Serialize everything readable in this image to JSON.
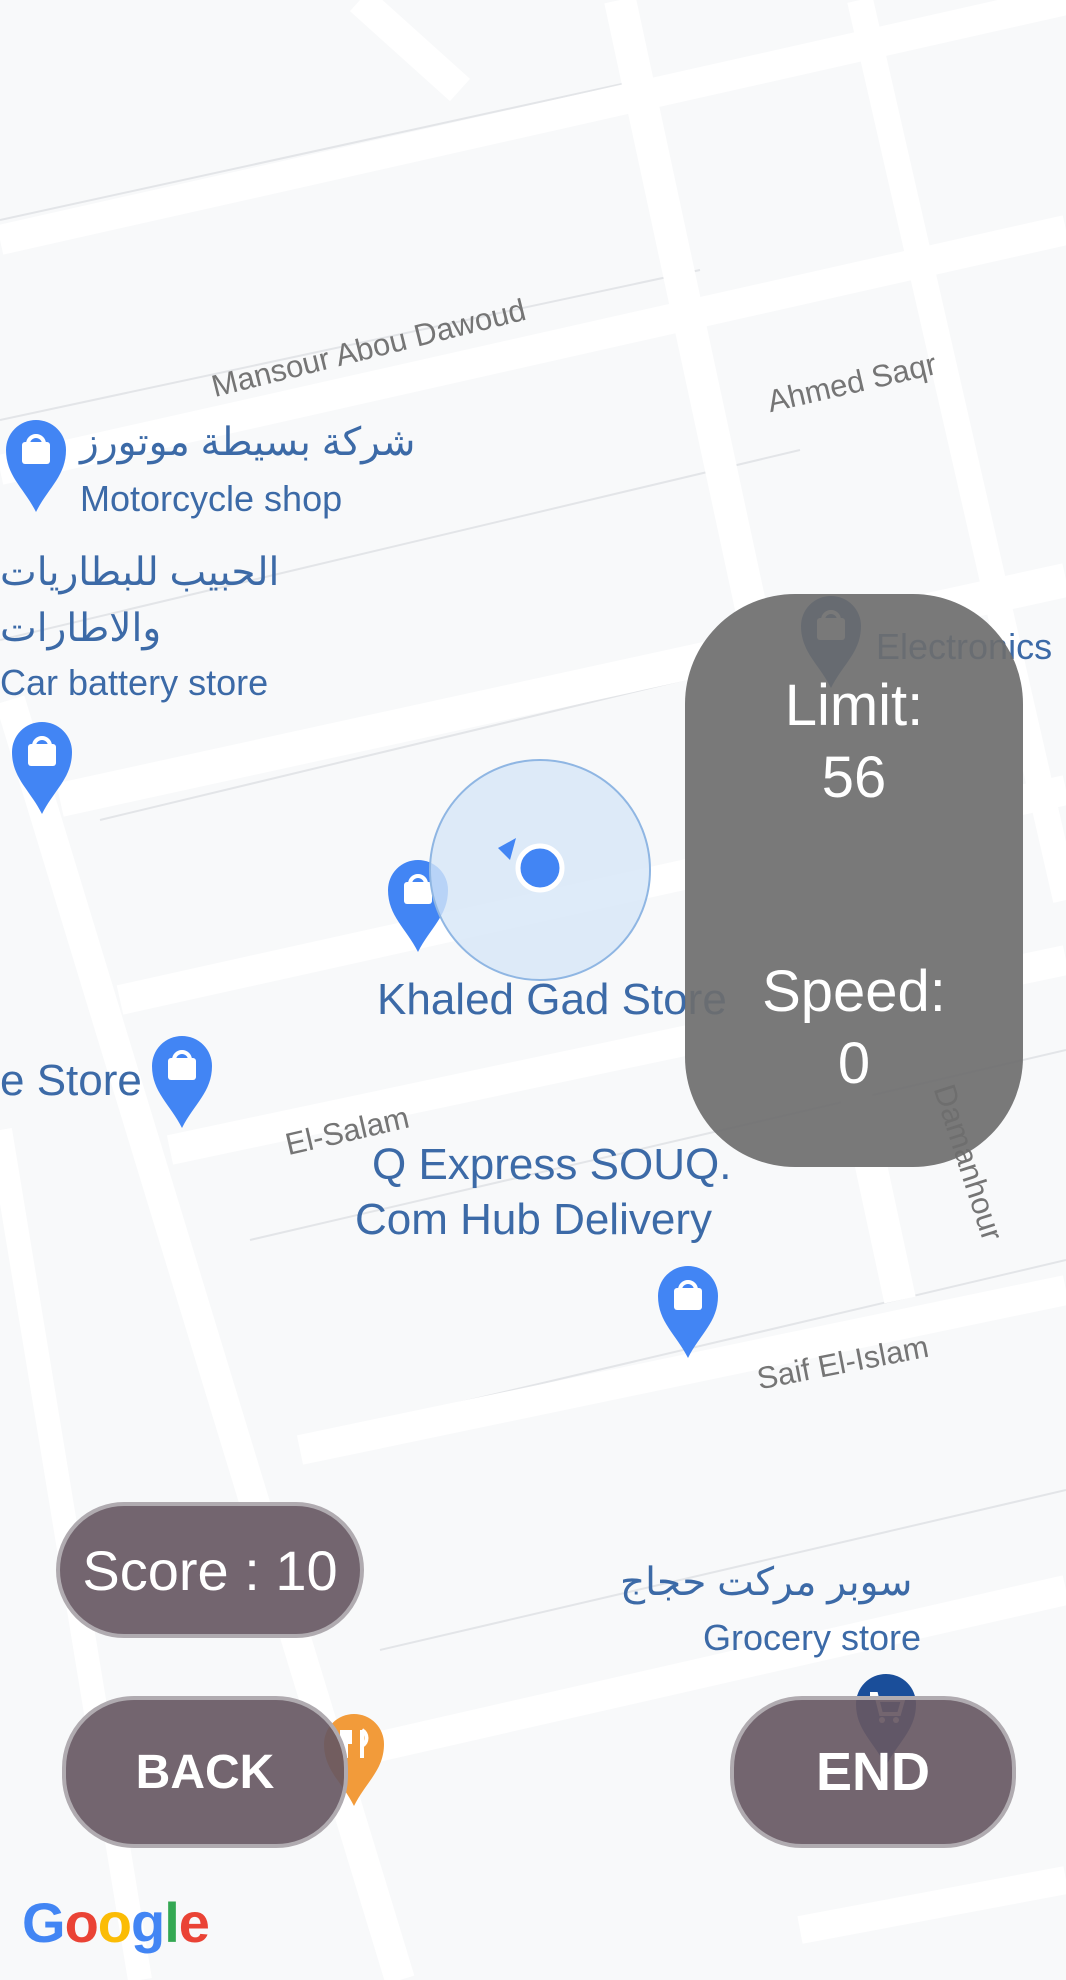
{
  "map": {
    "road_labels": {
      "mansour": "Mansour Abou Dawoud",
      "ahmed": "Ahmed Saqr",
      "elsalam": "El-Salam",
      "damanhour": "Damanhour",
      "saif": "Saif El-Islam"
    },
    "pois": {
      "motorcycle_ar": "شركة بسيطة موتورز",
      "motorcycle_en": "Motorcycle shop",
      "battery_ar_1": "الحبيب للبطاريات",
      "battery_ar_2": "والاطارات",
      "battery_en": "Car battery store",
      "electronics": "Electronics",
      "khaled": "Khaled Gad Store",
      "store_partial": "e Store",
      "qexpress_1": "Q Express SOUQ.",
      "qexpress_2": "Com Hub Delivery",
      "grocery_ar": "سوبر مركت حجاج",
      "grocery_en": "Grocery store"
    },
    "google_logo": "Google"
  },
  "speed_panel": {
    "limit_label": "Limit:",
    "limit_value": "56",
    "speed_label": "Speed:",
    "speed_value": "0"
  },
  "score": {
    "text": "Score : 10"
  },
  "buttons": {
    "back": "BACK",
    "end": "END"
  },
  "colors": {
    "road": "#ffffff",
    "block": "#f8f9fa",
    "pin_blue": "#4285f4",
    "pin_dark": "#1a4e9a",
    "pin_orange": "#f29b3a",
    "location_dot": "#4285f4",
    "accuracy_circle": "#d6e6f8"
  }
}
